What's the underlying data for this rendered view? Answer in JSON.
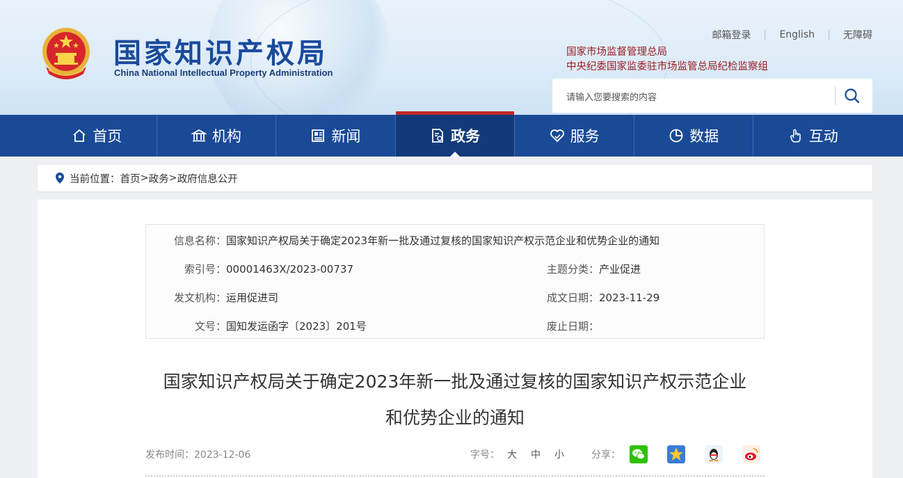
{
  "header": {
    "logo_cn": "国家知识产权局",
    "logo_en": "China National Intellectual Property Administration",
    "top_links": [
      "邮箱登录",
      "English",
      "无障碍"
    ],
    "org_line1": "国家市场监督管理总局",
    "org_line2": "中央纪委国家监委驻市场监管总局纪检监察组",
    "search_placeholder": "请输入您要搜索的内容"
  },
  "nav": {
    "items": [
      {
        "label": "首页",
        "icon": "home-icon"
      },
      {
        "label": "机构",
        "icon": "institution-icon"
      },
      {
        "label": "新闻",
        "icon": "news-icon"
      },
      {
        "label": "政务",
        "icon": "government-affairs-icon",
        "active": true
      },
      {
        "label": "服务",
        "icon": "service-icon"
      },
      {
        "label": "数据",
        "icon": "data-pie-icon"
      },
      {
        "label": "互动",
        "icon": "interaction-icon"
      }
    ]
  },
  "breadcrumb": {
    "prefix": "当前位置：",
    "items": [
      "首页",
      "政务",
      "政府信息公开"
    ],
    "separator": ">"
  },
  "info_table": {
    "name_label": "信息名称：",
    "name_value": "国家知识产权局关于确定2023年新一批及通过复核的国家知识产权示范企业和优势企业的通知",
    "index_label": "索引号：",
    "index_value": "00001463X/2023-00737",
    "topic_label": "主题分类：",
    "topic_value": "产业促进",
    "org_label": "发文机构：",
    "org_value": "运用促进司",
    "date_label": "成文日期：",
    "date_value": "2023-11-29",
    "docno_label": "文号：",
    "docno_value": "国知发运函字〔2023〕201号",
    "expire_label": "废止日期：",
    "expire_value": ""
  },
  "article": {
    "title_line1": "国家知识产权局关于确定2023年新一批及通过复核的国家知识产权示范企业",
    "title_line2": "和优势企业的通知",
    "publish_label": "发布时间：",
    "publish_date": "2023-12-06",
    "font_label": "字号：",
    "font_sizes": [
      "大",
      "中",
      "小"
    ],
    "share_label": "分享："
  },
  "colors": {
    "nav_bg": "#1a4a96",
    "nav_active": "#123a7a",
    "accent_red": "#c0282c",
    "org_text": "#9b1e23",
    "logo_blue": "#1a4a9c"
  }
}
